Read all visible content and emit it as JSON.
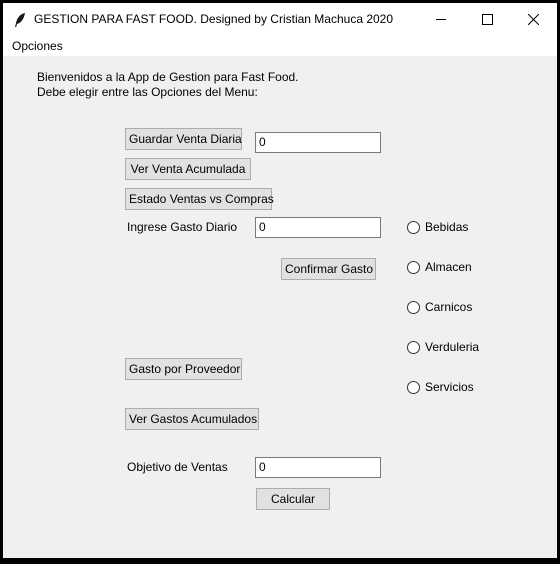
{
  "window": {
    "title": "GESTION PARA FAST FOOD. Designed by Cristian Machuca 2020"
  },
  "menu": {
    "items": [
      "Opciones"
    ]
  },
  "welcome": {
    "line1": "Bienvenidos a la App de Gestion para Fast Food.",
    "line2": "Debe elegir entre las Opciones del Menu:"
  },
  "buttons": {
    "guardar_venta_diaria": "Guardar Venta Diaria",
    "ver_venta_acumulada": "Ver Venta Acumulada",
    "estado_ventas_compras": "Estado Ventas vs Compras",
    "confirmar_gasto": "Confirmar Gasto",
    "gasto_por_proveedor": "Gasto por Proveedor",
    "ver_gastos_acumulados": "Ver Gastos Acumulados",
    "calcular": "Calcular"
  },
  "fields": {
    "venta_diaria": {
      "value": "0"
    },
    "gasto_diario": {
      "label": "Ingrese Gasto Diario",
      "value": "0"
    },
    "objetivo_ventas": {
      "label": "Objetivo de Ventas",
      "value": "0"
    }
  },
  "categories": [
    "Bebidas",
    "Almacen",
    "Carnicos",
    "Verduleria",
    "Servicios"
  ]
}
